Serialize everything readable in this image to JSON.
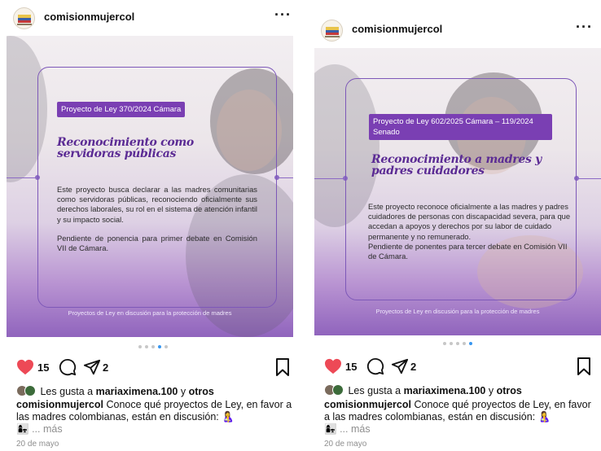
{
  "posts": [
    {
      "username": "comisionmujercol",
      "more_glyph": "···",
      "image": {
        "tag": "Proyecto de Ley 370/2024 Cámara",
        "title": "Reconocimiento como servidoras públicas",
        "paragraphs": [
          "Este proyecto busca declarar a las madres comunitarias como servidoras públicas, reconociendo oficialmente sus derechos laborales, su rol en el sistema de atención infantil y su impacto social.",
          "Pendiente de ponencia para primer debate en Comisión VII de Cámara."
        ],
        "footer": "Proyectos de Ley en discusión para la protección de madres"
      },
      "carousel": {
        "count": 5,
        "active": 3
      },
      "likes": "15",
      "shares": "2",
      "liked_prefix": "Les gusta a",
      "liked_user": "mariaximena.100",
      "liked_mid": "y",
      "liked_others": "otros",
      "caption_user": "comisionmujercol",
      "caption_text": "Conoce qué proyectos de Ley, en favor a las madres colombianas, están en discusión:",
      "caption_emoji_1": "🤱",
      "caption_emoji_2": "👩‍👧",
      "caption_more": "... más",
      "date": "20 de mayo"
    },
    {
      "username": "comisionmujercol",
      "more_glyph": "···",
      "image": {
        "tag": "Proyecto de Ley 602/2025 Cámara – 119/2024 Senado",
        "title": "Reconocimiento a madres y padres cuidadores",
        "paragraphs": [
          "Este proyecto reconoce oficialmente a las madres y padres cuidadores de personas con discapacidad severa, para que accedan a apoyos y derechos por su labor de cuidado permanente y no remunerado.",
          "Pendiente de ponentes para tercer debate en Comisión VII de Cámara."
        ],
        "footer": "Proyectos de Ley en discusión para la protección de madres"
      },
      "carousel": {
        "count": 5,
        "active": 4
      },
      "likes": "15",
      "shares": "2",
      "liked_prefix": "Les gusta a",
      "liked_user": "mariaximena.100",
      "liked_mid": "y",
      "liked_others": "otros",
      "caption_user": "comisionmujercol",
      "caption_text": "Conoce qué proyectos de Ley, en favor a las madres colombianas, están en discusión:",
      "caption_emoji_1": "🤱",
      "caption_emoji_2": "👩‍👧",
      "caption_more": "... más",
      "date": "20 de mayo"
    }
  ],
  "colors": {
    "accent_purple": "#7a3fb3",
    "title_purple": "#5b2b94",
    "like_red": "#ed4956",
    "carousel_active": "#3897f0"
  },
  "icons": {
    "like": "heart-icon",
    "comment": "comment-icon",
    "share": "share-icon",
    "save": "bookmark-icon"
  }
}
